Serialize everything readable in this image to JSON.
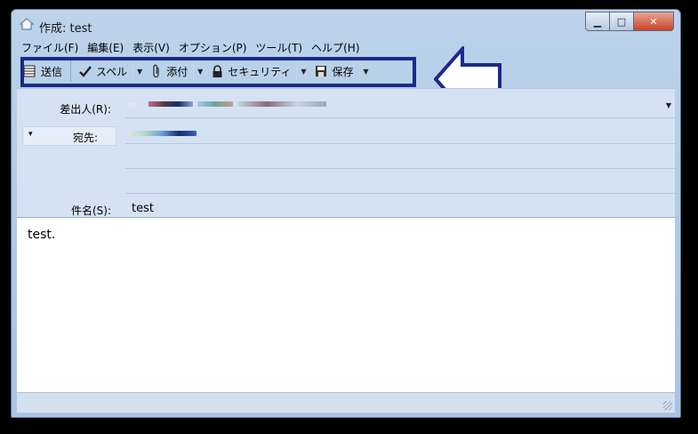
{
  "window": {
    "title": "作成: test",
    "buttons": {
      "minimize": "▁",
      "maximize": "□",
      "close": "✕"
    }
  },
  "menu": [
    "ファイル(F)",
    "編集(E)",
    "表示(V)",
    "オプション(P)",
    "ツール(T)",
    "ヘルプ(H)"
  ],
  "toolbar": {
    "send": "送信",
    "spell": "スペル",
    "attach": "添付",
    "security": "セキュリティ",
    "save": "保存",
    "dropdown": "▼"
  },
  "header": {
    "from_label": "差出人(R):",
    "to_label": "宛先:",
    "subject_label": "件名(S):",
    "subject_value": "test",
    "address_type_arrow": "▾"
  },
  "body": {
    "text": "test."
  },
  "colors": {
    "highlight": "#1a2a8c",
    "toolbar_bg": "#bcd3ea",
    "header_bg": "#d4e2f3"
  },
  "icons": [
    "app-icon",
    "send-icon",
    "check-icon",
    "paperclip-icon",
    "lock-icon",
    "floppy-icon",
    "highlight-arrow-icon"
  ]
}
